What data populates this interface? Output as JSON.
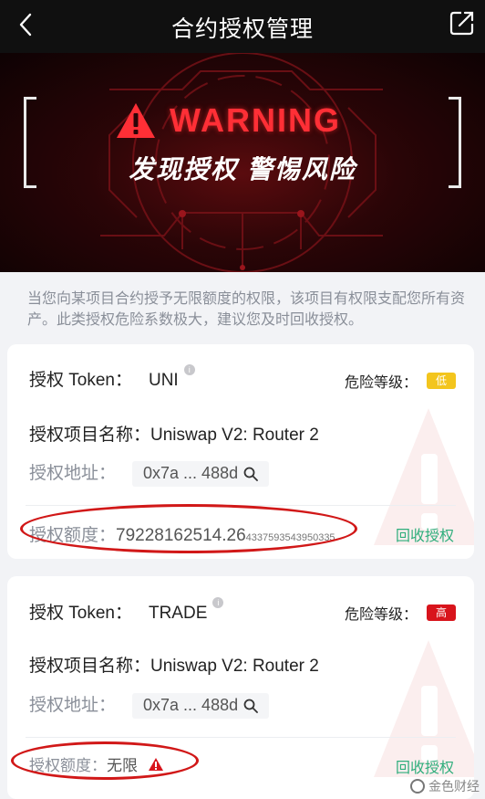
{
  "header": {
    "title": "合约授权管理",
    "back_icon": "chevron-left-icon",
    "share_icon": "share-icon"
  },
  "banner": {
    "warning_text": "WARNING",
    "subtitle": "发现授权 警惕风险"
  },
  "notice": "当您向某项目合约授予无限额度的权限，该项目有权限支配您所有资产。此类授权危险系数极大，建议您及时回收授权。",
  "cards": [
    {
      "token_label": "授权 Token：",
      "token": "UNI",
      "risk_label": "危险等级：",
      "risk": "低",
      "project_label": "授权项目名称：",
      "project": "Uniswap V2: Router 2",
      "address_label": "授权地址：",
      "address": "0x7a ... 488d",
      "amount_label": "授权额度：",
      "amount_main": "79228162514.26",
      "amount_tail": "4337593543950335",
      "revoke": "回收授权"
    },
    {
      "token_label": "授权 Token：",
      "token": "TRADE",
      "risk_label": "危险等级：",
      "risk": "高",
      "project_label": "授权项目名称：",
      "project": "Uniswap V2: Router 2",
      "address_label": "授权地址：",
      "address": "0x7a ... 488d",
      "amount_label": "授权额度：",
      "amount_main": "无限",
      "revoke": "回收授权"
    }
  ],
  "watermark": "金色财经",
  "colors": {
    "header_bg": "#101010",
    "warning_red": "#ff2f36",
    "risk_low": "#f3c51d",
    "risk_high": "#d8141c",
    "revoke_green": "#2fae7c",
    "highlight_ellipse": "#d11818"
  }
}
